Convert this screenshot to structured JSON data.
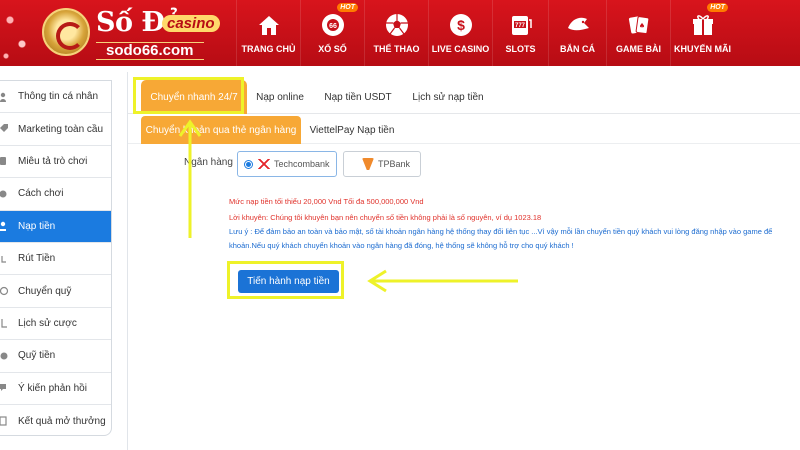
{
  "brand": {
    "name": "Số Đỏ",
    "casino": "casino",
    "domain": "sodo66.com"
  },
  "nav": {
    "items": [
      {
        "label": "TRANG CHỦ",
        "icon": "home-icon",
        "badge": ""
      },
      {
        "label": "XỔ SỐ",
        "icon": "lottery-ball-icon",
        "badge": "HOT"
      },
      {
        "label": "THỂ THAO",
        "icon": "soccer-ball-icon",
        "badge": ""
      },
      {
        "label": "LIVE CASINO",
        "icon": "dollar-coin-icon",
        "badge": ""
      },
      {
        "label": "SLOTS",
        "icon": "slot-machine-icon",
        "badge": ""
      },
      {
        "label": "BẮN CÁ",
        "icon": "fish-icon",
        "badge": ""
      },
      {
        "label": "GAME BÀI",
        "icon": "playing-cards-icon",
        "badge": ""
      },
      {
        "label": "KHUYẾN MÃI",
        "icon": "gift-icon",
        "badge": "HOT"
      }
    ]
  },
  "sidebar": {
    "items": [
      {
        "label": "Thông tin cá nhân",
        "icon": "user-icon"
      },
      {
        "label": "Marketing toàn cầu",
        "icon": "tag-icon"
      },
      {
        "label": "Miêu tả trò chơi",
        "icon": "gamepad-icon"
      },
      {
        "label": "Cách chơi",
        "icon": "circle-icon"
      },
      {
        "label": "Nạp tiền",
        "icon": "hand-coin-icon"
      },
      {
        "label": "Rút Tiền",
        "icon": "wallet-icon"
      },
      {
        "label": "Chuyển quỹ",
        "icon": "refresh-icon"
      },
      {
        "label": "Lịch sử cược",
        "icon": "history-icon"
      },
      {
        "label": "Quỹ tiền",
        "icon": "money-icon"
      },
      {
        "label": "Ý kiến phản hồi",
        "icon": "feedback-icon"
      },
      {
        "label": "Kết quả mở thưởng",
        "icon": "list-icon"
      }
    ],
    "active_index": 4
  },
  "deposit": {
    "tabs": [
      "Chuyển nhanh 24/7",
      "Nạp online",
      "Nạp tiền USDT",
      "Lịch sử nạp tiền"
    ],
    "subtabs": [
      "Chuyển khoản qua thẻ ngân hàng",
      "ViettelPay Nạp tiền"
    ],
    "bank_label": "Ngân hàng",
    "banks": [
      {
        "name": "Techcombank",
        "selected": true
      },
      {
        "name": "TPBank",
        "selected": false
      }
    ],
    "notes": {
      "limit": "Mức nạp tiền tối thiểu 20,000 Vnd Tối đa 500,000,000 Vnd",
      "advice": "Lời khuyên: Chúng tôi khuyên bạn nên chuyển số tiền không phải là số nguyên, ví dụ 1023.18",
      "caution1": "Lưu ý : Để đảm bảo an toàn và bảo mật, số tài khoản ngân hàng hệ thống thay đổi liên tục ...Vì vậy mỗi lần chuyển tiền quý khách vui lòng đăng nhập vào game để",
      "caution2": "khoản.Nếu quý khách chuyển khoản vào ngân hàng đã đóng, hệ thống sẽ không hỗ trợ cho quý khách !"
    },
    "submit_label": "Tiến hành nạp tiền"
  },
  "colors": {
    "header_red": "#c8101a",
    "tab_orange": "#f7a836",
    "active_blue": "#1b7be0",
    "annotation_yellow": "#eef229"
  }
}
